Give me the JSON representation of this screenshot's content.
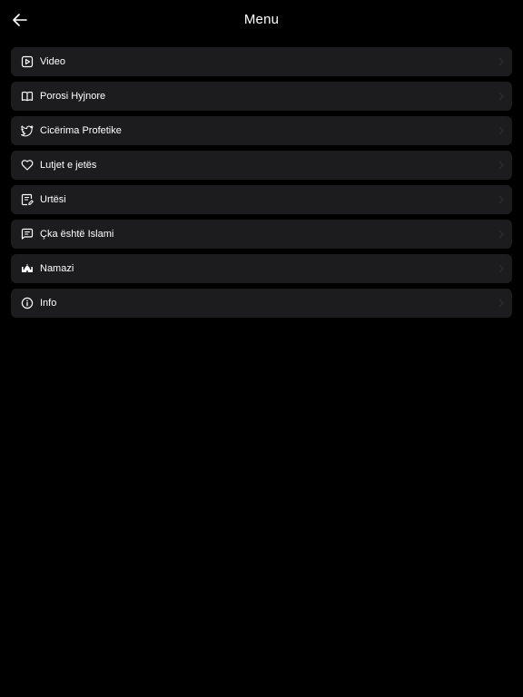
{
  "header": {
    "title": "Menu",
    "back_icon": "arrow-left-icon"
  },
  "menu": {
    "items": [
      {
        "label": "Video",
        "icon": "play-square-icon"
      },
      {
        "label": "Porosi Hyjnore",
        "icon": "book-open-icon"
      },
      {
        "label": "Cicërima Profetike",
        "icon": "bird-icon"
      },
      {
        "label": "Lutjet e jetës",
        "icon": "heart-icon"
      },
      {
        "label": "Urtësi",
        "icon": "note-edit-icon"
      },
      {
        "label": "Çka është Islami",
        "icon": "message-square-icon"
      },
      {
        "label": "Namazi",
        "icon": "mosque-icon"
      },
      {
        "label": "Info",
        "icon": "info-icon"
      }
    ],
    "chevron_icon": "chevron-right-icon"
  },
  "colors": {
    "background": "#000000",
    "row_background": "#1c1c1e",
    "text": "#ffffff",
    "chevron": "#2c2c2e"
  }
}
